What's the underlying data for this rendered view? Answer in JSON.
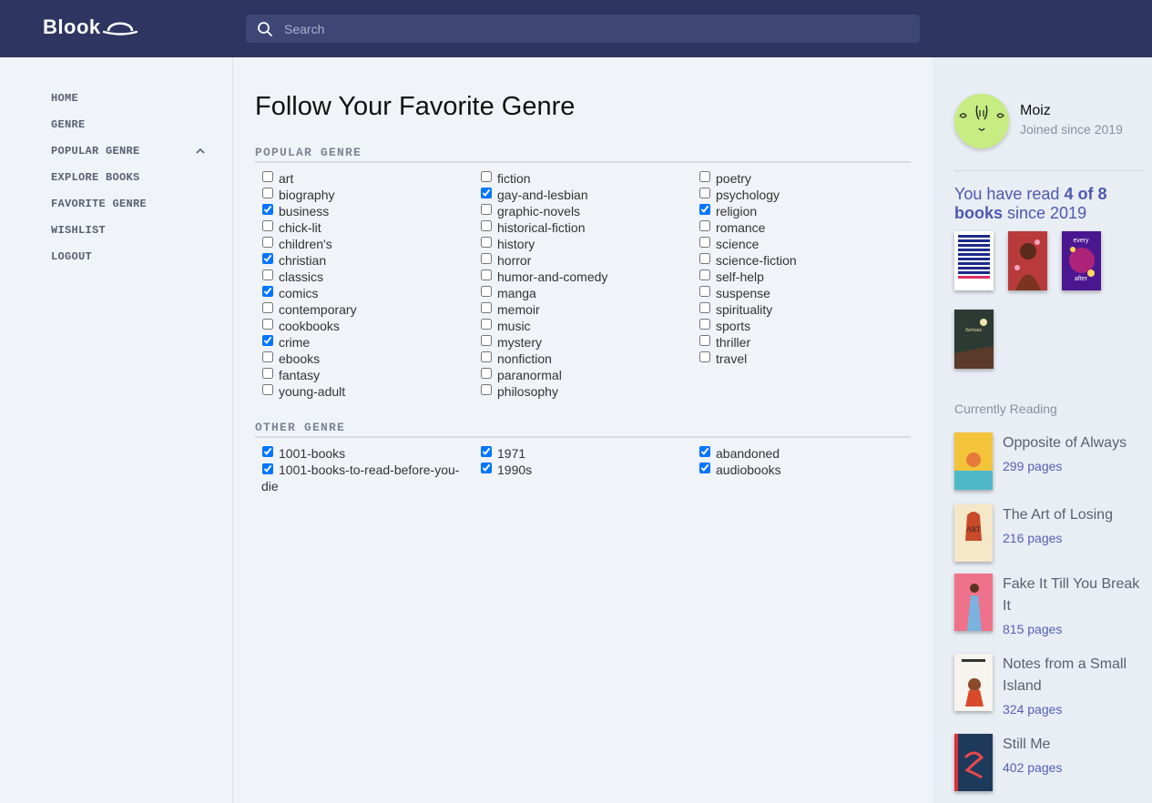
{
  "app": {
    "logo": "Blook"
  },
  "search": {
    "placeholder": "Search"
  },
  "nav": {
    "items": [
      {
        "label": "HOME"
      },
      {
        "label": "GENRE"
      },
      {
        "label": "POPULAR GENRE"
      },
      {
        "label": "EXPLORE BOOKS"
      },
      {
        "label": "FAVORITE GENRE"
      },
      {
        "label": "WISHLIST"
      },
      {
        "label": "LOGOUT"
      }
    ]
  },
  "main": {
    "title": "Follow Your Favorite Genre",
    "popular": {
      "heading": "POPULAR GENRE",
      "items": [
        {
          "label": "art",
          "checked": false
        },
        {
          "label": "biography",
          "checked": false
        },
        {
          "label": "business",
          "checked": true
        },
        {
          "label": "chick-lit",
          "checked": false
        },
        {
          "label": "children's",
          "checked": false
        },
        {
          "label": "christian",
          "checked": true
        },
        {
          "label": "classics",
          "checked": false
        },
        {
          "label": "comics",
          "checked": true
        },
        {
          "label": "contemporary",
          "checked": false
        },
        {
          "label": "cookbooks",
          "checked": false
        },
        {
          "label": "crime",
          "checked": true
        },
        {
          "label": "ebooks",
          "checked": false
        },
        {
          "label": "fantasy",
          "checked": false
        },
        {
          "label": "young-adult",
          "checked": false
        },
        {
          "label": "fiction",
          "checked": false
        },
        {
          "label": "gay-and-lesbian",
          "checked": true
        },
        {
          "label": "graphic-novels",
          "checked": false
        },
        {
          "label": "historical-fiction",
          "checked": false
        },
        {
          "label": "history",
          "checked": false
        },
        {
          "label": "horror",
          "checked": false
        },
        {
          "label": "humor-and-comedy",
          "checked": false
        },
        {
          "label": "manga",
          "checked": false
        },
        {
          "label": "memoir",
          "checked": false
        },
        {
          "label": "music",
          "checked": false
        },
        {
          "label": "mystery",
          "checked": false
        },
        {
          "label": "nonfiction",
          "checked": false
        },
        {
          "label": "paranormal",
          "checked": false
        },
        {
          "label": "philosophy",
          "checked": false
        },
        {
          "label": "poetry",
          "checked": false
        },
        {
          "label": "psychology",
          "checked": false
        },
        {
          "label": "religion",
          "checked": true
        },
        {
          "label": "romance",
          "checked": false
        },
        {
          "label": "science",
          "checked": false
        },
        {
          "label": "science-fiction",
          "checked": false
        },
        {
          "label": "self-help",
          "checked": false
        },
        {
          "label": "suspense",
          "checked": false
        },
        {
          "label": "spirituality",
          "checked": false
        },
        {
          "label": "sports",
          "checked": false
        },
        {
          "label": "thriller",
          "checked": false
        },
        {
          "label": "travel",
          "checked": false
        }
      ]
    },
    "other": {
      "heading": "OTHER GENRE",
      "items": [
        {
          "label": "1001-books",
          "checked": true
        },
        {
          "label": "1001-books-to-read-before-you-die",
          "checked": true
        },
        {
          "label": "1971",
          "checked": true
        },
        {
          "label": "1990s",
          "checked": true
        },
        {
          "label": "abandoned",
          "checked": true
        },
        {
          "label": "audiobooks",
          "checked": true
        }
      ]
    }
  },
  "profile": {
    "name": "Moiz",
    "joined": "Joined since 2019",
    "read_prefix": "You have read ",
    "read_count": "4 of 8",
    "read_books": "books",
    "read_suffix": " since 2019",
    "read_covers": [
      {
        "name": "Never Enough",
        "color": "#ffffff"
      },
      {
        "name": "With the Fire on High",
        "color": "#b83a3a"
      },
      {
        "name": "every moment after",
        "color": "#6a1fb0"
      },
      {
        "name": "Serious Moonlight",
        "color": "#2b3330"
      }
    ]
  },
  "currently_reading": {
    "heading": "Currently Reading",
    "books": [
      {
        "title": "Opposite of Always",
        "pages": "299 pages",
        "color": "#f3c43a"
      },
      {
        "title": "The Art of Losing",
        "pages": "216 pages",
        "color": "#f5e8c8"
      },
      {
        "title": "Fake It Till You Break It",
        "pages": "815 pages",
        "color": "#f0718a"
      },
      {
        "title": "Notes from a Small Island",
        "pages": "324 pages",
        "color": "#f7f4ef"
      },
      {
        "title": "Still Me",
        "pages": "402 pages",
        "color": "#1e3a5a"
      }
    ]
  }
}
